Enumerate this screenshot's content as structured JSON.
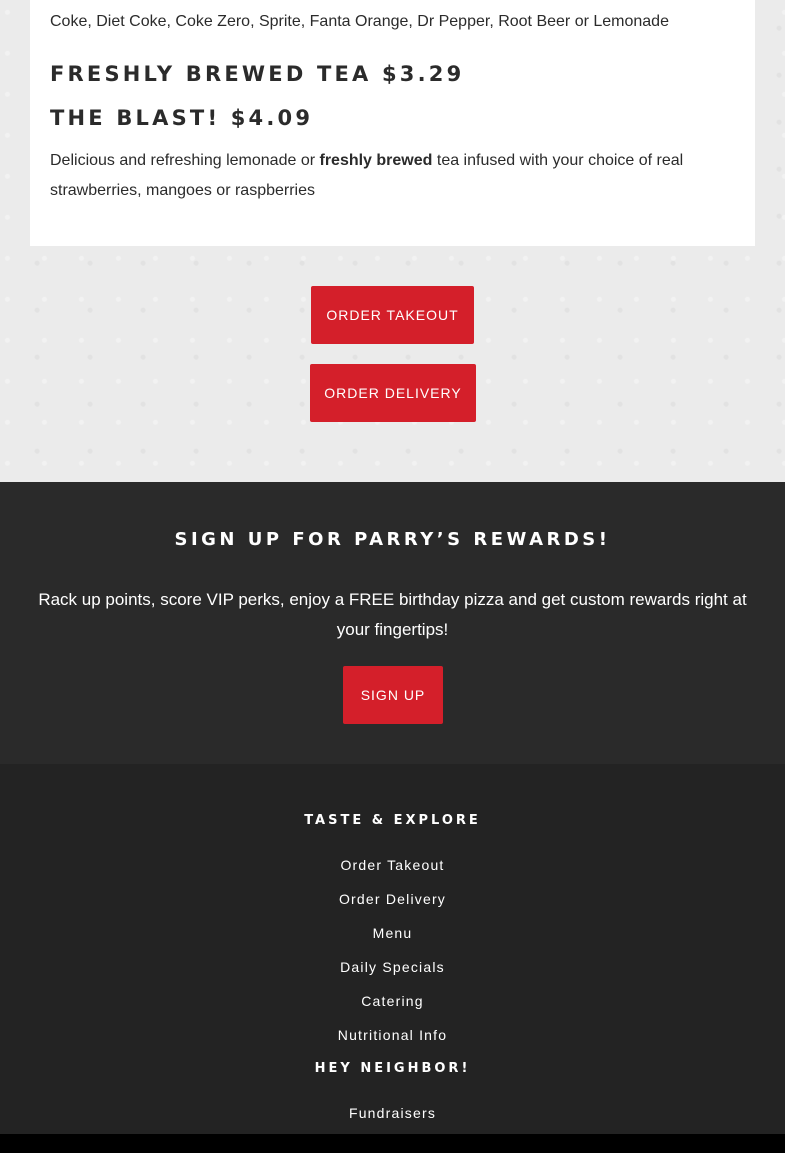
{
  "menu": {
    "soda_description": "Coke, Diet Coke, Coke Zero, Sprite, Fanta Orange, Dr Pepper, Root Beer or Lemonade",
    "tea_heading": "FRESHLY BREWED TEA $3.29",
    "blast_heading": "THE BLAST! $4.09",
    "blast_desc_before": "Delicious and refreshing lemonade or ",
    "blast_desc_bold": "freshly brewed",
    "blast_desc_after": " tea infused with your choice of real strawberries, mangoes or raspberries"
  },
  "actions": {
    "order_takeout": "ORDER TAKEOUT",
    "order_delivery": "ORDER DELIVERY"
  },
  "rewards": {
    "title": "SIGN UP FOR PARRY’S REWARDS!",
    "text": "Rack up points, score VIP perks, enjoy a FREE birthday pizza and get custom rewards right at your fingertips!",
    "signup": "SIGN UP"
  },
  "footer": {
    "section1_heading": "TASTE & EXPLORE",
    "links": [
      "Order Takeout",
      "Order Delivery",
      "Menu",
      "Daily Specials",
      "Catering",
      "Nutritional Info"
    ],
    "section2_heading": "HEY NEIGHBOR!",
    "links2": [
      "Fundraisers"
    ]
  },
  "colors": {
    "accent": "#d41f2a",
    "rewards_bg": "#2a2a2a",
    "footer_bg": "#232323"
  }
}
